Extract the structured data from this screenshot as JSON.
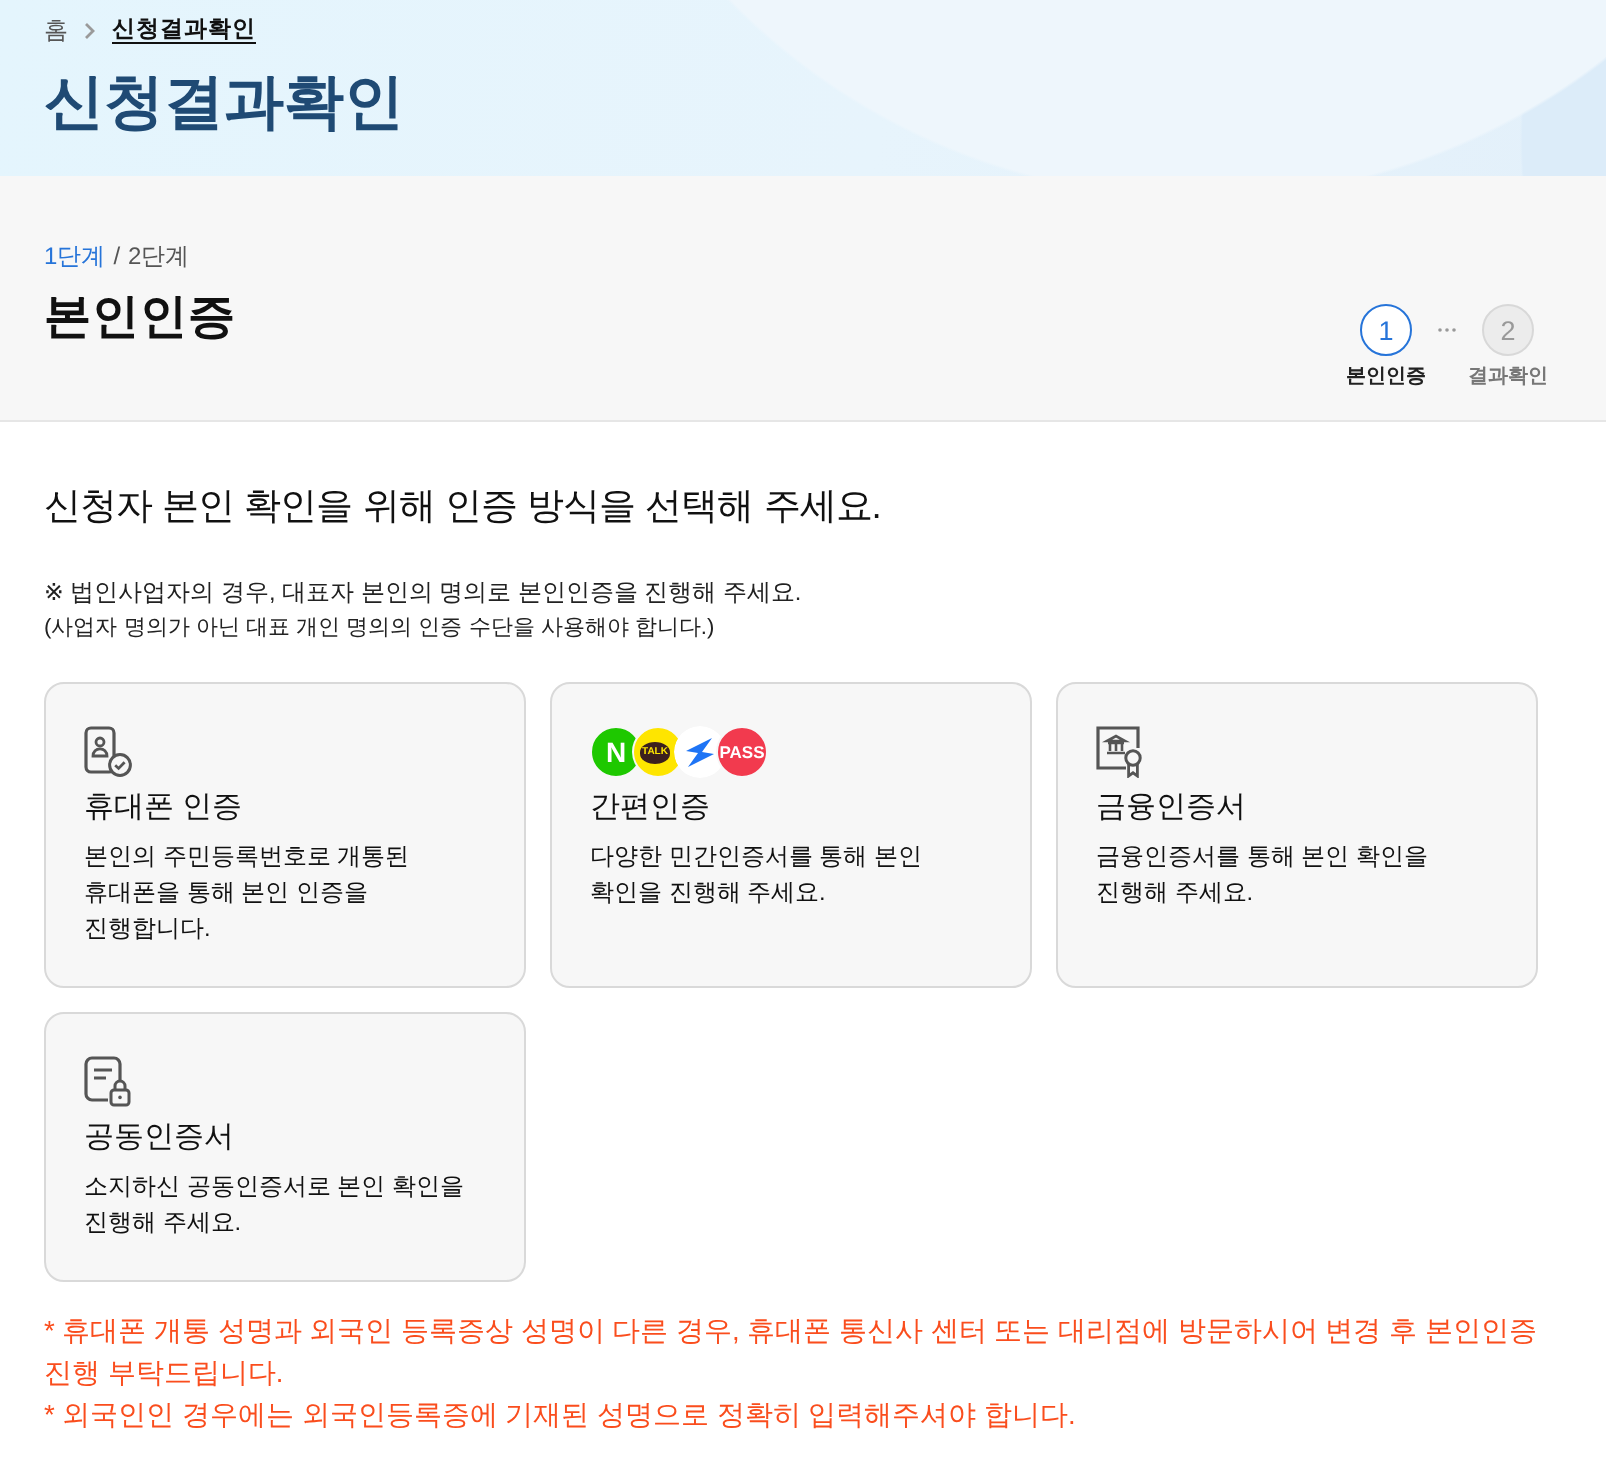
{
  "breadcrumb": [
    {
      "label": "홈",
      "current": false
    },
    {
      "label": "신청결과확인",
      "current": true
    }
  ],
  "page_title": "신청결과확인",
  "step_header": {
    "current": "1단계",
    "separator": "/",
    "total": "2단계",
    "title": "본인인증"
  },
  "stepper": [
    {
      "number": "1",
      "label": "본인인증",
      "selected": true
    },
    {
      "number": "2",
      "label": "결과확인",
      "selected": false
    }
  ],
  "instruction": "신청자 본인 확인을 위해 인증 방식을 선택해 주세요.",
  "notes": [
    "※ 법인사업자의 경우, 대표자 본인의 명의로 본인인증을 진행해 주세요.",
    "(사업자 명의가 아닌 대표 개인 명의의 인증 수단을 사용해야 합니다.)"
  ],
  "methods": [
    {
      "kind": "phone",
      "title": "휴대폰 인증",
      "description": [
        "본인의 주민등록번호로 개통된",
        "휴대폰을 통해 본인 인증을",
        "진행합니다."
      ]
    },
    {
      "kind": "simple",
      "title": "간편인증",
      "description": [
        "다양한 민간인증서를 통해 본인",
        "확인을 진행해 주세요."
      ],
      "logos": [
        {
          "kind": "letter",
          "label": "N",
          "color": "#1ec800"
        },
        {
          "kind": "bubble",
          "label": "TALK",
          "color": "#fee500"
        },
        {
          "kind": "bolt",
          "color": "#ffffff"
        },
        {
          "kind": "letter",
          "label": "PASS",
          "color": "#f23a4e"
        }
      ]
    },
    {
      "kind": "financial",
      "title": "금융인증서",
      "description": [
        "금융인증서를 통해 본인 확인을",
        "진행해 주세요."
      ]
    },
    {
      "kind": "joint",
      "title": "공동인증서",
      "description": [
        "소지하신 공동인증서로 본인 확인을",
        "진행해 주세요."
      ]
    }
  ],
  "warnings": [
    "* 휴대폰 개통 성명과 외국인 등록증상 성명이 다른 경우, 휴대폰 통신사 센터 또는 대리점에 방문하시어 변경 후 본인인증 진행 부탁드립니다.",
    "* 외국인인 경우에는 외국인등록증에 기재된 성명으로 정확히 입력해주셔야 합니다."
  ]
}
